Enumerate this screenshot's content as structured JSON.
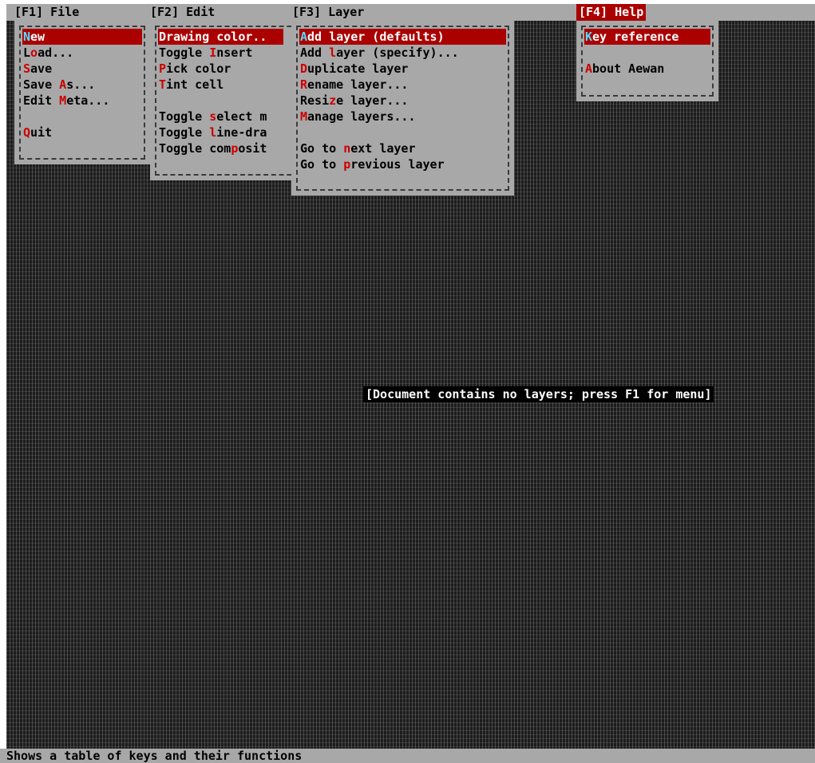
{
  "menubar": {
    "file": "[F1] File",
    "edit": "[F2] Edit",
    "layer": "[F3] Layer",
    "help": "[F4] Help"
  },
  "file_menu": {
    "items": [
      {
        "a": "",
        "k": "N",
        "b": "ew"
      },
      {
        "a": "L",
        "k": "o",
        "b": "ad..."
      },
      {
        "a": "",
        "k": "S",
        "b": "ave"
      },
      {
        "a": "Save ",
        "k": "A",
        "b": "s..."
      },
      {
        "a": "Edit ",
        "k": "M",
        "b": "eta..."
      },
      {
        "a": "",
        "k": "Q",
        "b": "uit"
      }
    ]
  },
  "edit_menu": {
    "items": [
      {
        "a": "Drawing color..",
        "k": "",
        "b": ""
      },
      {
        "a": "Toggle ",
        "k": "I",
        "b": "nsert"
      },
      {
        "a": "",
        "k": "P",
        "b": "ick color"
      },
      {
        "a": "",
        "k": "T",
        "b": "int cell"
      },
      {
        "a": "Toggle ",
        "k": "s",
        "b": "elect m"
      },
      {
        "a": "Toggle ",
        "k": "l",
        "b": "ine-dra"
      },
      {
        "a": "Toggle com",
        "k": "p",
        "b": "osit"
      }
    ]
  },
  "layer_menu": {
    "items": [
      {
        "a": "",
        "k": "A",
        "b": "dd layer (defaults)"
      },
      {
        "a": "Add ",
        "k": "l",
        "b": "ayer (specify)..."
      },
      {
        "a": "",
        "k": "D",
        "b": "uplicate layer"
      },
      {
        "a": "",
        "k": "R",
        "b": "ename layer..."
      },
      {
        "a": "Resi",
        "k": "z",
        "b": "e layer..."
      },
      {
        "a": "",
        "k": "M",
        "b": "anage layers..."
      },
      {
        "a": "Go to ",
        "k": "n",
        "b": "ext layer"
      },
      {
        "a": "Go to ",
        "k": "p",
        "b": "revious layer"
      }
    ]
  },
  "help_menu": {
    "items": [
      {
        "a": "",
        "k": "K",
        "b": "ey reference"
      },
      {
        "a": "",
        "k": "A",
        "b": "bout Aewan"
      }
    ]
  },
  "notice": "[Document contains no layers; press F1 for menu]",
  "status": "Shows a table of keys and their functions",
  "colors": {
    "background": "#1c1c1c",
    "menu": "#a8a8a8",
    "highlight": "#aa0000",
    "hotkey": "#cc0000"
  }
}
